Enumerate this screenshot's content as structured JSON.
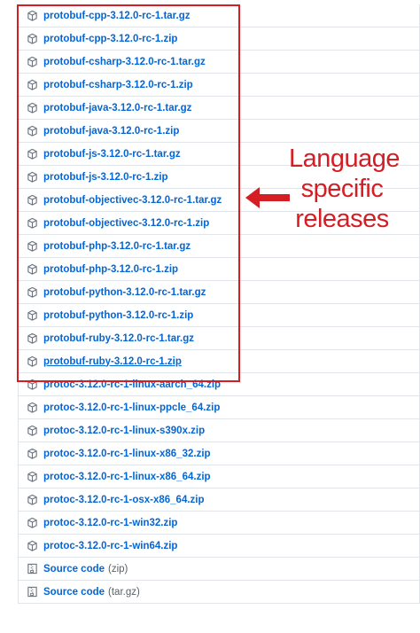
{
  "assets": [
    {
      "name": "protobuf-cpp-3.12.0-rc-1.tar.gz",
      "icon": "package-icon"
    },
    {
      "name": "protobuf-cpp-3.12.0-rc-1.zip",
      "icon": "package-icon"
    },
    {
      "name": "protobuf-csharp-3.12.0-rc-1.tar.gz",
      "icon": "package-icon"
    },
    {
      "name": "protobuf-csharp-3.12.0-rc-1.zip",
      "icon": "package-icon"
    },
    {
      "name": "protobuf-java-3.12.0-rc-1.tar.gz",
      "icon": "package-icon"
    },
    {
      "name": "protobuf-java-3.12.0-rc-1.zip",
      "icon": "package-icon"
    },
    {
      "name": "protobuf-js-3.12.0-rc-1.tar.gz",
      "icon": "package-icon"
    },
    {
      "name": "protobuf-js-3.12.0-rc-1.zip",
      "icon": "package-icon"
    },
    {
      "name": "protobuf-objectivec-3.12.0-rc-1.tar.gz",
      "icon": "package-icon"
    },
    {
      "name": "protobuf-objectivec-3.12.0-rc-1.zip",
      "icon": "package-icon"
    },
    {
      "name": "protobuf-php-3.12.0-rc-1.tar.gz",
      "icon": "package-icon"
    },
    {
      "name": "protobuf-php-3.12.0-rc-1.zip",
      "icon": "package-icon"
    },
    {
      "name": "protobuf-python-3.12.0-rc-1.tar.gz",
      "icon": "package-icon"
    },
    {
      "name": "protobuf-python-3.12.0-rc-1.zip",
      "icon": "package-icon"
    },
    {
      "name": "protobuf-ruby-3.12.0-rc-1.tar.gz",
      "icon": "package-icon"
    },
    {
      "name": "protobuf-ruby-3.12.0-rc-1.zip",
      "icon": "package-icon",
      "underlined": true
    },
    {
      "name": "protoc-3.12.0-rc-1-linux-aarch_64.zip",
      "icon": "package-icon"
    },
    {
      "name": "protoc-3.12.0-rc-1-linux-ppcle_64.zip",
      "icon": "package-icon"
    },
    {
      "name": "protoc-3.12.0-rc-1-linux-s390x.zip",
      "icon": "package-icon"
    },
    {
      "name": "protoc-3.12.0-rc-1-linux-x86_32.zip",
      "icon": "package-icon"
    },
    {
      "name": "protoc-3.12.0-rc-1-linux-x86_64.zip",
      "icon": "package-icon"
    },
    {
      "name": "protoc-3.12.0-rc-1-osx-x86_64.zip",
      "icon": "package-icon"
    },
    {
      "name": "protoc-3.12.0-rc-1-win32.zip",
      "icon": "package-icon"
    },
    {
      "name": "protoc-3.12.0-rc-1-win64.zip",
      "icon": "package-icon"
    },
    {
      "name": "Source code",
      "suffix": "(zip)",
      "icon": "file-zip-icon"
    },
    {
      "name": "Source code",
      "suffix": "(tar.gz)",
      "icon": "file-zip-icon"
    }
  ],
  "annotation": {
    "lines": [
      "Language",
      "specific",
      "releases"
    ],
    "arrow_icon": "left-arrow-icon"
  },
  "colors": {
    "link": "#0366d6",
    "muted": "#586069",
    "border": "#e1e4e8",
    "annotation_red": "#d51d24"
  }
}
